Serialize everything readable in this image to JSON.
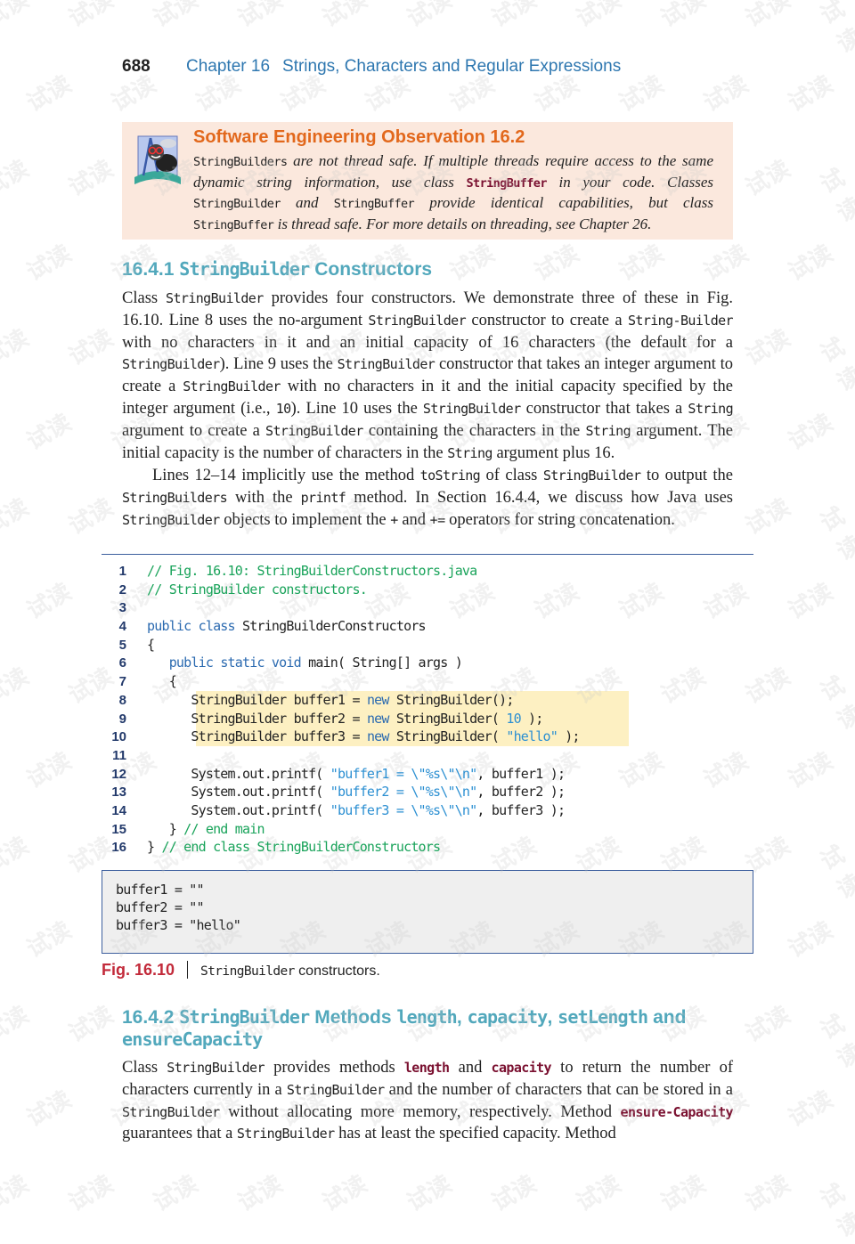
{
  "header": {
    "page_number": "688",
    "chapter": "Chapter 16",
    "chapter_title": "Strings, Characters and Regular Expressions"
  },
  "observation": {
    "icon": "bug-mascot-icon",
    "title": "Software Engineering Observation 16.2",
    "segments": [
      {
        "t": "StringBuilders",
        "s": "mono"
      },
      {
        "t": " are not thread safe. If multiple threads require access to the same dynamic string information, use class ",
        "s": "text"
      },
      {
        "t": "StringBuffer",
        "s": "strong"
      },
      {
        "t": " in your code. Classes ",
        "s": "text"
      },
      {
        "t": "StringBuilder",
        "s": "mono"
      },
      {
        "t": " and ",
        "s": "text"
      },
      {
        "t": "StringBuffer",
        "s": "mono"
      },
      {
        "t": " provide identical capabilities, but class ",
        "s": "text"
      },
      {
        "t": "StringBuffer",
        "s": "mono"
      },
      {
        "t": " is thread safe. For more details on threading, see Chapter 26.",
        "s": "text"
      }
    ]
  },
  "section1": {
    "number": "16.4.1",
    "title_code": "StringBuilder",
    "title_rest": "Constructors",
    "paragraph1": [
      {
        "t": "Class ",
        "s": "text"
      },
      {
        "t": "StringBuilder",
        "s": "mono"
      },
      {
        "t": " provides four constructors. We demonstrate three of these in Fig. 16.10. Line 8 uses the no-argument ",
        "s": "text"
      },
      {
        "t": "StringBuilder",
        "s": "mono"
      },
      {
        "t": " constructor to create a ",
        "s": "text"
      },
      {
        "t": "String-Builder",
        "s": "mono"
      },
      {
        "t": " with no characters in it and an initial capacity of 16 characters (the default for a ",
        "s": "text"
      },
      {
        "t": "StringBuilder",
        "s": "mono"
      },
      {
        "t": "). Line 9 uses the ",
        "s": "text"
      },
      {
        "t": "StringBuilder",
        "s": "mono"
      },
      {
        "t": " constructor that takes an integer argument to create a ",
        "s": "text"
      },
      {
        "t": "StringBuilder",
        "s": "mono"
      },
      {
        "t": " with no characters in it and the initial capacity specified by the integer argument (i.e., ",
        "s": "text"
      },
      {
        "t": "10",
        "s": "mono"
      },
      {
        "t": "). Line 10 uses the ",
        "s": "text"
      },
      {
        "t": "StringBuilder",
        "s": "mono"
      },
      {
        "t": " constructor that takes a ",
        "s": "text"
      },
      {
        "t": "String",
        "s": "mono"
      },
      {
        "t": " argument to create a ",
        "s": "text"
      },
      {
        "t": "StringBuilder",
        "s": "mono"
      },
      {
        "t": " containing the characters in the ",
        "s": "text"
      },
      {
        "t": "String",
        "s": "mono"
      },
      {
        "t": " argument. The initial capacity is the number of characters in the ",
        "s": "text"
      },
      {
        "t": "String",
        "s": "mono"
      },
      {
        "t": " argument plus 16.",
        "s": "text"
      }
    ],
    "paragraph2": [
      {
        "t": "Lines 12–14 implicitly use the method ",
        "s": "text"
      },
      {
        "t": "toString",
        "s": "mono"
      },
      {
        "t": " of class ",
        "s": "text"
      },
      {
        "t": "StringBuilder",
        "s": "mono"
      },
      {
        "t": " to output the ",
        "s": "text"
      },
      {
        "t": "StringBuilders",
        "s": "mono"
      },
      {
        "t": " with the ",
        "s": "text"
      },
      {
        "t": "printf",
        "s": "mono"
      },
      {
        "t": " method. In Section 16.4.4, we discuss how Java uses ",
        "s": "text"
      },
      {
        "t": "StringBuilder",
        "s": "mono"
      },
      {
        "t": " objects to implement the ",
        "s": "text"
      },
      {
        "t": "+",
        "s": "mono"
      },
      {
        "t": " and ",
        "s": "text"
      },
      {
        "t": "+=",
        "s": "mono"
      },
      {
        "t": " operators for string concatenation.",
        "s": "text"
      }
    ]
  },
  "code": {
    "highlight_lines": [
      8,
      9,
      10
    ],
    "lines": [
      {
        "n": "1",
        "tokens": [
          {
            "t": "// Fig. 16.10: StringBuilderConstructors.java",
            "s": "comment"
          }
        ]
      },
      {
        "n": "2",
        "tokens": [
          {
            "t": "// StringBuilder constructors.",
            "s": "comment"
          }
        ]
      },
      {
        "n": "3",
        "tokens": []
      },
      {
        "n": "4",
        "tokens": [
          {
            "t": "public class",
            "s": "kw"
          },
          {
            "t": " StringBuilderConstructors",
            "s": "plain"
          }
        ]
      },
      {
        "n": "5",
        "tokens": [
          {
            "t": "{",
            "s": "plain"
          }
        ]
      },
      {
        "n": "6",
        "tokens": [
          {
            "t": "   ",
            "s": "plain"
          },
          {
            "t": "public static void",
            "s": "kw"
          },
          {
            "t": " main( String[] args )",
            "s": "plain"
          }
        ]
      },
      {
        "n": "7",
        "tokens": [
          {
            "t": "   {",
            "s": "plain"
          }
        ]
      },
      {
        "n": "8",
        "tokens": [
          {
            "t": "      StringBuilder buffer1 = ",
            "s": "plain"
          },
          {
            "t": "new",
            "s": "kw"
          },
          {
            "t": " StringBuilder();",
            "s": "plain"
          }
        ]
      },
      {
        "n": "9",
        "tokens": [
          {
            "t": "      StringBuilder buffer2 = ",
            "s": "plain"
          },
          {
            "t": "new",
            "s": "kw"
          },
          {
            "t": " StringBuilder( ",
            "s": "plain"
          },
          {
            "t": "10",
            "s": "num"
          },
          {
            "t": " );",
            "s": "plain"
          }
        ]
      },
      {
        "n": "10",
        "tokens": [
          {
            "t": "      StringBuilder buffer3 = ",
            "s": "plain"
          },
          {
            "t": "new",
            "s": "kw"
          },
          {
            "t": " StringBuilder( ",
            "s": "plain"
          },
          {
            "t": "\"hello\"",
            "s": "str"
          },
          {
            "t": " );",
            "s": "plain"
          }
        ]
      },
      {
        "n": "11",
        "tokens": []
      },
      {
        "n": "12",
        "tokens": [
          {
            "t": "      System.out.printf( ",
            "s": "plain"
          },
          {
            "t": "\"buffer1 = \\\"%s\\\"\\n\"",
            "s": "str"
          },
          {
            "t": ", buffer1 );",
            "s": "plain"
          }
        ]
      },
      {
        "n": "13",
        "tokens": [
          {
            "t": "      System.out.printf( ",
            "s": "plain"
          },
          {
            "t": "\"buffer2 = \\\"%s\\\"\\n\"",
            "s": "str"
          },
          {
            "t": ", buffer2 );",
            "s": "plain"
          }
        ]
      },
      {
        "n": "14",
        "tokens": [
          {
            "t": "      System.out.printf( ",
            "s": "plain"
          },
          {
            "t": "\"buffer3 = \\\"%s\\\"\\n\"",
            "s": "str"
          },
          {
            "t": ", buffer3 );",
            "s": "plain"
          }
        ]
      },
      {
        "n": "15",
        "tokens": [
          {
            "t": "   } ",
            "s": "plain"
          },
          {
            "t": "// end main",
            "s": "comment"
          }
        ]
      },
      {
        "n": "16",
        "tokens": [
          {
            "t": "} ",
            "s": "plain"
          },
          {
            "t": "// end class StringBuilderConstructors",
            "s": "comment"
          }
        ]
      }
    ]
  },
  "output": {
    "lines": [
      "buffer1 = \"\"",
      "buffer2 = \"\"",
      "buffer3 = \"hello\""
    ]
  },
  "caption": {
    "label": "Fig. 16.10",
    "code": "StringBuilder",
    "text": " constructors."
  },
  "section2": {
    "number": "16.4.2",
    "title_parts": [
      {
        "t": "StringBuilder",
        "s": "mono"
      },
      {
        "t": " Methods ",
        "s": "text"
      },
      {
        "t": "length",
        "s": "mono"
      },
      {
        "t": ", ",
        "s": "text"
      },
      {
        "t": "capacity",
        "s": "mono"
      },
      {
        "t": ", ",
        "s": "text"
      },
      {
        "t": "setLength",
        "s": "mono"
      },
      {
        "t": " and",
        "s": "text"
      }
    ],
    "title_line2": "ensureCapacity",
    "paragraph": [
      {
        "t": "Class ",
        "s": "text"
      },
      {
        "t": "StringBuilder",
        "s": "mono"
      },
      {
        "t": " provides methods ",
        "s": "text"
      },
      {
        "t": "length",
        "s": "kw"
      },
      {
        "t": " and ",
        "s": "text"
      },
      {
        "t": "capacity",
        "s": "kw"
      },
      {
        "t": " to return the number of characters currently in a ",
        "s": "text"
      },
      {
        "t": "StringBuilder",
        "s": "mono"
      },
      {
        "t": " and the number of characters that can be stored in a ",
        "s": "text"
      },
      {
        "t": "StringBuilder",
        "s": "mono"
      },
      {
        "t": " without allocating more memory, respectively. Method ",
        "s": "text"
      },
      {
        "t": "ensure-Capacity",
        "s": "kw"
      },
      {
        "t": " guarantees that a ",
        "s": "text"
      },
      {
        "t": "StringBuilder",
        "s": "mono"
      },
      {
        "t": " has at least the specified capacity. Method",
        "s": "text"
      }
    ]
  },
  "colors": {
    "chapter_blue": "#2e77b0",
    "observation_orange": "#e2681c",
    "observation_bg": "#fbe8dd",
    "section_teal": "#52a8bc",
    "keyword_maroon": "#7a1030",
    "code_comment": "#19a35a",
    "code_keyword": "#2b6ab0",
    "code_string": "#2b8fd2",
    "highlight": "#fdf0c2",
    "figure_red": "#c22a3a"
  }
}
